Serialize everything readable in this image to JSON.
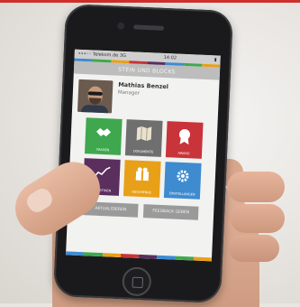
{
  "page": {
    "border_color": "#cf2f2b"
  },
  "phone_screen": {
    "status_bar": {
      "carrier": "•••◦◦ Telekom.de  3G",
      "time": "14:02",
      "battery": "▮"
    },
    "title": "STEIN UND BLOCKS",
    "profile": {
      "name": "Mathias Benzel",
      "role": "Manager"
    },
    "tiles": [
      {
        "label": "FRAGEN",
        "icon": "handshake-icon",
        "color": "#3fa84e"
      },
      {
        "label": "DOKUMENTE",
        "icon": "map-icon",
        "color": "#6f6f6f"
      },
      {
        "label": "AWARD",
        "icon": "award-icon",
        "color": "#c8343a"
      },
      {
        "label": "STATISTIKEN",
        "icon": "chart-icon",
        "color": "#5a2f5e"
      },
      {
        "label": "GESCHENKE",
        "icon": "gift-icon",
        "color": "#e8a018"
      },
      {
        "label": "EINSTELLUNGEN",
        "icon": "settings-gear-icon",
        "color": "#3e8bd0"
      }
    ],
    "buttons": {
      "left": "AKTUALISIEREN",
      "right": "FEEDBACK GEBEN"
    },
    "strip_colors": [
      "#3e8bd0",
      "#3fa84e",
      "#e8a018",
      "#c8343a",
      "#5a2f5e",
      "#3e8bd0",
      "#3fa84e",
      "#e8a018"
    ]
  }
}
